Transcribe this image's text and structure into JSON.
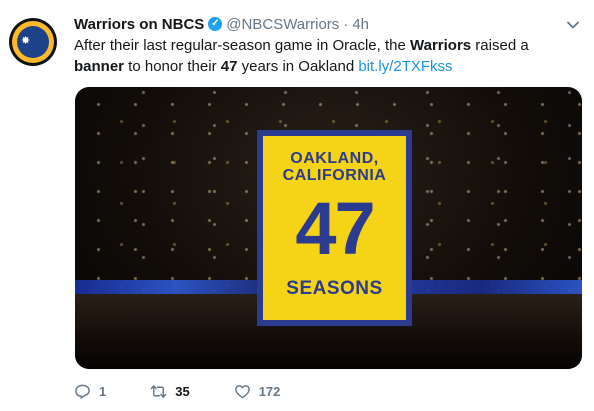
{
  "tweet": {
    "display_name": "Warriors on NBCS",
    "handle": "@NBCSWarriors",
    "separator": "·",
    "time": "4h",
    "text_parts": {
      "p1": "After their last regular-season game in Oracle, the ",
      "b1": "Warriors",
      "p2": " raised a ",
      "b2": "banner",
      "p3": " to honor their ",
      "b3": "47",
      "p4": " years in Oakland ",
      "link": "bit.ly/2TXFkss"
    }
  },
  "media": {
    "banner_line1": "OAKLAND,",
    "banner_line2": "CALIFORNIA",
    "banner_number": "47",
    "banner_bottom": "SEASONS"
  },
  "actions": {
    "replies": "1",
    "retweets": "35",
    "likes": "172"
  },
  "colors": {
    "link": "#1b95e0",
    "verified": "#1da1f2",
    "banner_yellow": "#f5d317",
    "banner_blue": "#2b3b8f"
  },
  "icons": [
    "verified-icon",
    "chevron-down-icon",
    "reply-icon",
    "retweet-icon",
    "like-icon"
  ]
}
